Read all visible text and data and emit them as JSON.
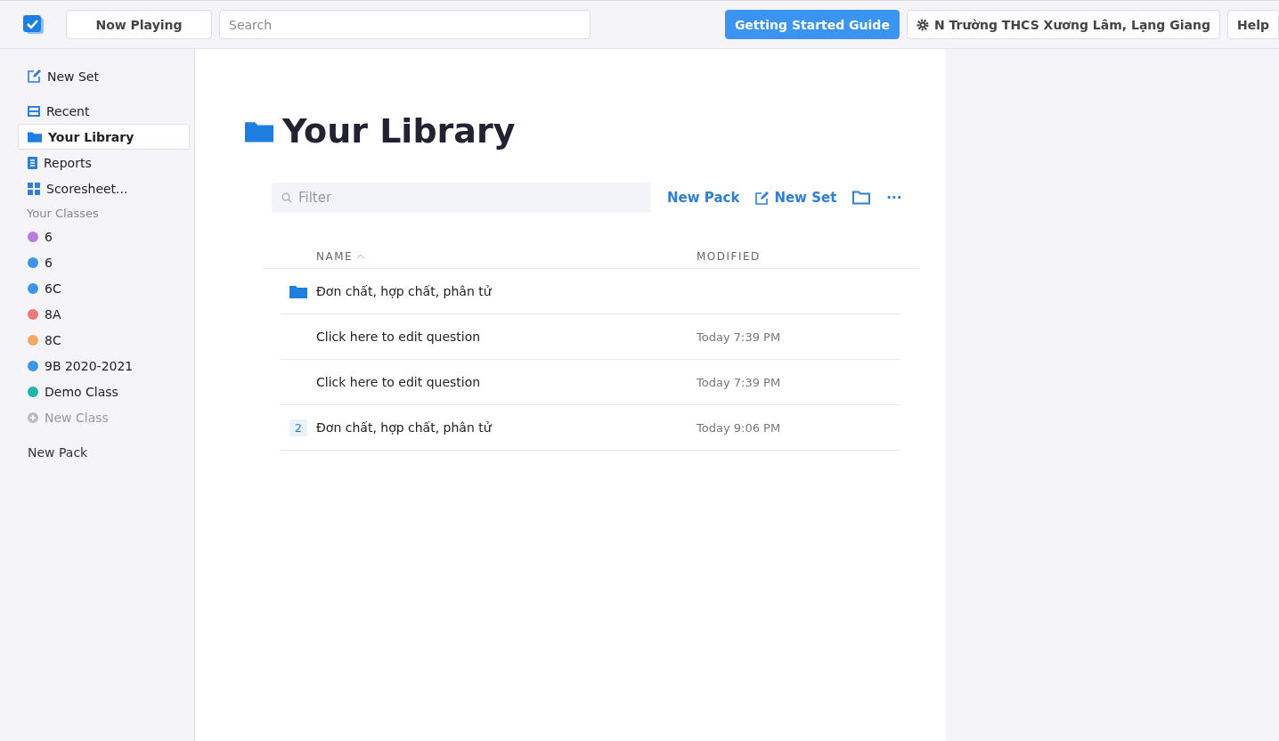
{
  "topbar": {
    "now_playing": "Now Playing",
    "search": {
      "placeholder": "Search"
    },
    "guide": "Getting Started Guide",
    "account": "N Trường THCS Xương Lâm, Lạng Giang",
    "help": "Help"
  },
  "sidebar": {
    "new_set": "New Set",
    "items": [
      {
        "kind": "recent",
        "label": "Recent",
        "selected": false
      },
      {
        "kind": "library",
        "label": "Your Library",
        "selected": true
      },
      {
        "kind": "reports",
        "label": "Reports",
        "selected": false
      },
      {
        "kind": "scoresheet",
        "label": "Scoresheet...",
        "selected": false
      }
    ],
    "classes_heading": "Your Classes",
    "classes": [
      {
        "label": "6",
        "color": "#b67ddb"
      },
      {
        "label": "6",
        "color": "#3d95ea"
      },
      {
        "label": "6C",
        "color": "#3d95ea"
      },
      {
        "label": "8A",
        "color": "#ec7a7a"
      },
      {
        "label": "8C",
        "color": "#f5a765"
      },
      {
        "label": "9B 2020-2021",
        "color": "#3d95ea"
      },
      {
        "label": "Demo Class",
        "color": "#1fb5ad"
      }
    ],
    "new_class": "New Class",
    "new_pack": "New Pack"
  },
  "library": {
    "title": "Your Library",
    "filter": {
      "placeholder": "Filter"
    },
    "new_pack": "New Pack",
    "new_set": "New Set",
    "more": "···",
    "columns": [
      "NAME",
      "MODIFIED"
    ],
    "rows": [
      {
        "kind": "folder",
        "name": "Đơn chất, hợp chất, phân tử"
      },
      {
        "kind": "question",
        "name": "Click here to edit question",
        "modified": "Today 7:39 PM"
      },
      {
        "kind": "question",
        "name": "Click here to edit question",
        "modified": "Today 7:39 PM"
      },
      {
        "kind": "pack",
        "count": "2",
        "name": "Đơn chất, hợp chất, phân tử",
        "modified": "Today 9:06 PM"
      }
    ]
  }
}
